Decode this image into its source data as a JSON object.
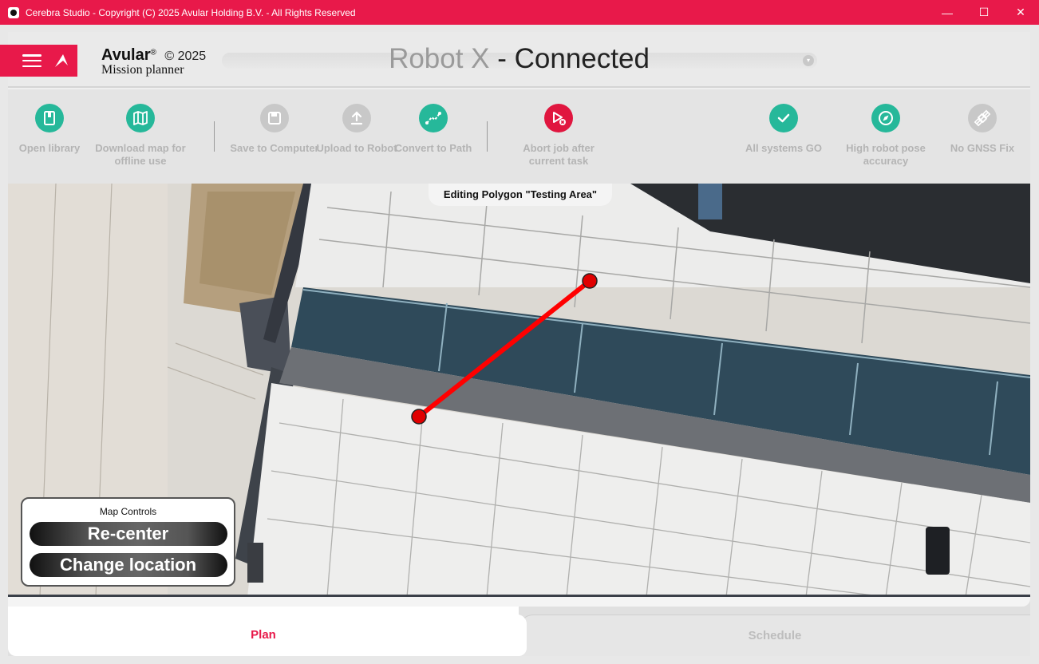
{
  "window": {
    "title": "Cerebra Studio - Copyright (C) 2025 Avular Holding B.V. - All Rights Reserved",
    "minimize": "—",
    "maximize": "☐",
    "close": "✕"
  },
  "header": {
    "brand_name": "Avular",
    "brand_reg": "®",
    "brand_year": "© 2025",
    "brand_sub": "Mission planner",
    "robot_name": "Robot X",
    "robot_status": " - Connected",
    "dropdown_icon": "▾"
  },
  "toolbar": {
    "open_library": "Open library",
    "download_map": "Download map for offline use",
    "save_to_computer": "Save to Computer",
    "upload_to_robot": "Upload to Robot",
    "convert_to_path": "Convert to Path",
    "abort_job": "Abort job after current task",
    "all_systems": "All systems GO",
    "pose_accuracy": "High robot pose accuracy",
    "gnss": "No GNSS Fix"
  },
  "map": {
    "editing_label": "Editing Polygon \"Testing Area\"",
    "controls_title": "Map Controls",
    "recenter": "Re-center",
    "change_location": "Change location",
    "edge_color": "#ff0000"
  },
  "tabs": {
    "plan": "Plan",
    "schedule": "Schedule"
  },
  "colors": {
    "accent": "#e8194a",
    "teal": "#26b89a",
    "disabled": "#c8c8c8"
  }
}
